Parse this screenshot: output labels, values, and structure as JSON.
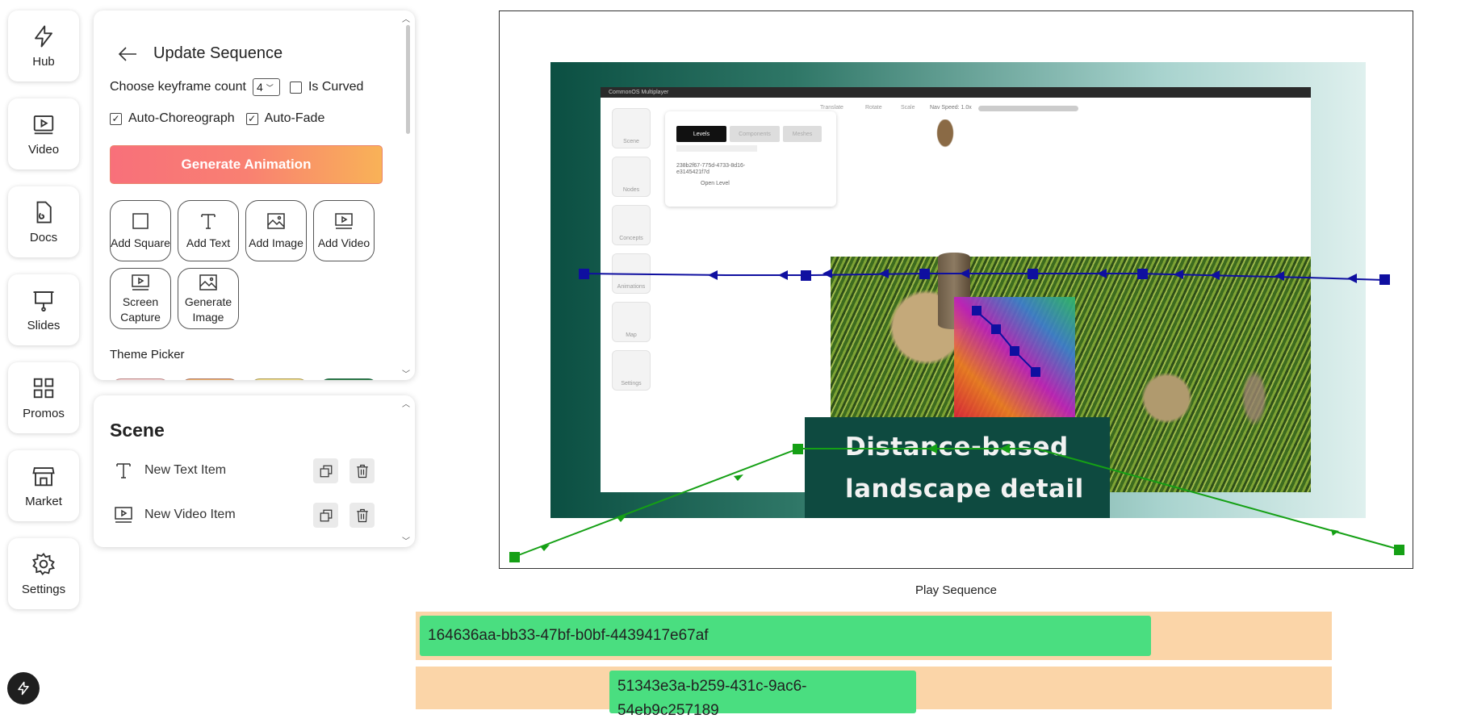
{
  "nav": [
    {
      "label": "Hub",
      "icon": "lightning-icon"
    },
    {
      "label": "Video",
      "icon": "video-icon"
    },
    {
      "label": "Docs",
      "icon": "docs-icon"
    },
    {
      "label": "Slides",
      "icon": "slides-icon"
    },
    {
      "label": "Promos",
      "icon": "grid-icon"
    },
    {
      "label": "Market",
      "icon": "market-icon"
    },
    {
      "label": "Settings",
      "icon": "gear-icon"
    }
  ],
  "editor": {
    "title": "Update Sequence",
    "keyframe_label": "Choose keyframe count",
    "keyframe_value": "4",
    "is_curved_label": "Is Curved",
    "is_curved_checked": false,
    "auto_choreograph_label": "Auto-Choreograph",
    "auto_choreograph_checked": true,
    "auto_fade_label": "Auto-Fade",
    "auto_fade_checked": true,
    "generate_label": "Generate Animation",
    "tools": [
      {
        "label": "Add Square",
        "icon": "square-icon"
      },
      {
        "label": "Add Text",
        "icon": "text-icon"
      },
      {
        "label": "Add Image",
        "icon": "image-icon"
      },
      {
        "label": "Add Video",
        "icon": "video-icon"
      },
      {
        "label": "Screen Capture",
        "icon": "screen-capture-icon"
      },
      {
        "label": "Generate Image",
        "icon": "image-icon"
      }
    ],
    "theme_label": "Theme Picker"
  },
  "scene": {
    "title": "Scene",
    "items": [
      {
        "label": "New Text Item",
        "icon": "text-icon"
      },
      {
        "label": "New Video Item",
        "icon": "video-icon"
      }
    ]
  },
  "preview": {
    "title_line1": "Distance-based",
    "title_line2": "landscape detail",
    "embedded": {
      "window_title": "CommonOS Multiplayer",
      "side": [
        "Scene",
        "Nodes",
        "Concepts",
        "Animations",
        "Map",
        "Settings"
      ],
      "tabs": [
        "Levels",
        "Components",
        "Meshes"
      ],
      "id_text": "238b2f67-775d-4733-8d16-e3145421f7d",
      "open_level": "Open Level",
      "toolbar": [
        "Translate",
        "Rotate",
        "Scale"
      ],
      "nav_speed": "Nav Speed: 1.0x"
    },
    "colors": {
      "path_blue": "#0f0fa0",
      "path_green": "#15a015",
      "title_bg": "#0e4a40"
    }
  },
  "play_label": "Play Sequence",
  "timeline": [
    {
      "id": "164636aa-bb33-47bf-b0bf-4439417e67af"
    },
    {
      "id_line1": "51343e3a-b259-431c-9ac6-",
      "id_line2": "54eb9c257189"
    }
  ]
}
